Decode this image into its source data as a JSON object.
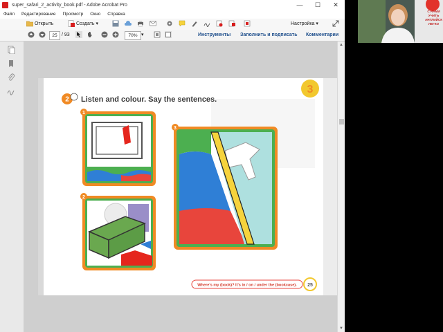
{
  "window": {
    "title": "super_safari_2_activity_book.pdf - Adobe Acrobat Pro",
    "minimize": "—",
    "maximize": "☐",
    "close": "✕"
  },
  "menu": {
    "items": [
      "Файл",
      "Редактирование",
      "Просмотр",
      "Окно",
      "Справка"
    ]
  },
  "toolbar": {
    "open_label": "Открыть",
    "create_label": "Создать",
    "customize_label": "Настройка"
  },
  "nav": {
    "current_page": "25",
    "total_pages": "/ 93",
    "zoom": "70%"
  },
  "panels": {
    "tools": "Инструменты",
    "fill_sign": "Заполнить и подписать",
    "comments": "Комментарии"
  },
  "document": {
    "exercise_number": "2",
    "instruction": "Listen and colour. Say the sentences.",
    "unit_badge": "3",
    "scene_numbers": [
      "1",
      "2",
      "3"
    ],
    "footer_sentence": "Where's my (book)? It's in / on / under the (bookcase).",
    "page_number": "25"
  },
  "webcam": {
    "banner_lines": [
      "С НАМИ",
      "УЧИТЬ",
      "АНГЛИЙСК",
      "ЛЕГКО"
    ]
  },
  "colors": {
    "accent_orange": "#f08a24",
    "scene_green": "#4caf50",
    "scene_blue": "#2f7fd6",
    "scene_red": "#e8453c",
    "scene_yellow": "#f6d33c",
    "badge_yellow": "#f2c82e"
  }
}
